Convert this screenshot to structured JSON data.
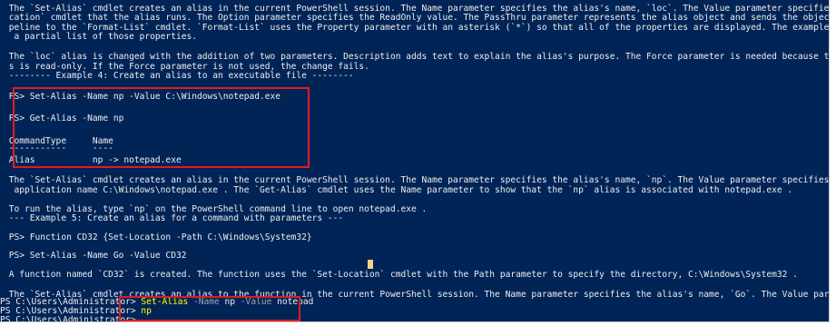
{
  "console": {
    "lines": [
      " The `Set-Alias` cmdlet creates an alias in the current PowerShell session. The Name parameter specifies the alias's name, `loc`. The Value parameter specifies the `Get-Lo",
      " cation` cmdlet that the alias runs. The Option parameter specifies the ReadOnly value. The PassThru parameter represents the alias object and sends the object down the pi",
      " peline to the `Format-List` cmdlet. `Format-List` uses the Property parameter with an asterisk (`*`) so that all of the properties are displayed. The example output shows",
      "  a partial list of those properties.",
      " The `loc` alias is changed with the addition of two parameters. Description adds text to explain the alias's purpose. The Force parameter is needed because the `loc` alia",
      " s is read-only. If the Force parameter is not used, the change fails.",
      " -------- Example 4: Create an alias to an executable file --------",
      " PS> Set-Alias -Name np -Value C:\\Windows\\notepad.exe",
      " PS> Get-Alias -Name np",
      " CommandType     Name",
      " -----------     ----",
      " Alias           np -> notepad.exe",
      " The `Set-Alias` cmdlet creates an alias in the current PowerShell session. The Name parameter specifies the alias's name, `np`. The Value parameter specifies the path and",
      "  application name C:\\Windows\\notepad.exe . The `Get-Alias` cmdlet uses the Name parameter to show that the `np` alias is associated with notepad.exe .",
      " To run the alias, type `np` on the PowerShell command line to open notepad.exe .",
      " --- Example 5: Create an alias for a command with parameters ---",
      " PS> Function CD32 {Set-Location -Path C:\\Windows\\System32}",
      " PS> Set-Alias -Name Go -Value CD32",
      " A function named `CD32` is created. The function uses the `Set-Location` cmdlet with the Path parameter to specify the directory, C:\\Windows\\System32 .",
      " The `Set-Alias` cmdlet creates an alias to the function in the current PowerShell session. The Name parameter specifies the alias's name, `Go`. The Value parameter specif"
    ],
    "prompts": [
      {
        "prefix": "PS C:\\Users\\Administrator> ",
        "cmd": "Set-Alias",
        "p1": " -Name ",
        "a1": "np",
        "p2": " -Value ",
        "a2": "notepad"
      },
      {
        "prefix": "PS C:\\Users\\Administrator> ",
        "cmd": "np"
      },
      {
        "prefix": "PS C:\\Users\\Administrator> "
      }
    ]
  },
  "colors": {
    "background": "#012456",
    "text": "#eeedf0",
    "command": "#ffff00",
    "parameter": "#9ea3ad",
    "highlight_box": "#e01b24"
  }
}
